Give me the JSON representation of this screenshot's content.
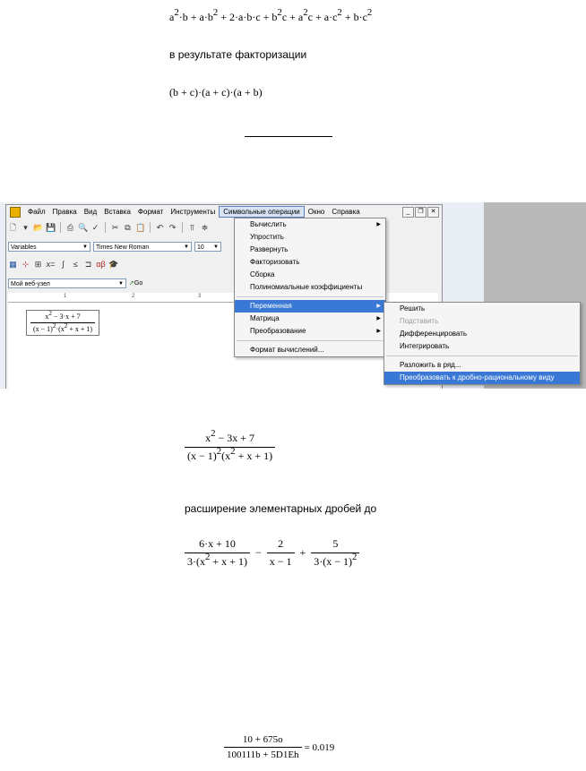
{
  "doc": {
    "expr1": [
      "a",
      "2",
      "·b + a·b",
      "2",
      " + 2·a·b·c + b",
      "2",
      "c + a",
      "2",
      "c + a·c",
      "2",
      " + b·c",
      "2"
    ],
    "label_factor": "в результате факторизации",
    "expr2": "(b + c)·(a + c)·(a + b)",
    "frac1": {
      "num": [
        "x",
        "2",
        " − 3x + 7"
      ],
      "den": [
        "(x − 1)",
        "2",
        "(x",
        "2",
        " + x + 1)"
      ]
    },
    "label_partial": "расширение элементарных дробей до",
    "partial": {
      "t1_num": "6·x + 10",
      "t1_den": [
        "3·(x",
        "2",
        " + x + 1)"
      ],
      "op1": "−",
      "t2_num": "2",
      "t2_den": "x − 1",
      "op2": "+",
      "t3_num": "5",
      "t3_den": [
        "3·(x − 1)",
        "2"
      ]
    },
    "final": {
      "num": "10 + 675o",
      "den": "100111b + 5D1Eh",
      "result": "= 0.019"
    }
  },
  "app": {
    "menu": [
      "Файл",
      "Правка",
      "Вид",
      "Вставка",
      "Формат",
      "Инструменты",
      "Символьные операции",
      "Окно",
      "Справка"
    ],
    "active_menu": "Символьные операции",
    "style_combo": "Variables",
    "font_combo": "Times New Roman",
    "size_combo": "10",
    "url_combo": "Мой веб-узел",
    "go_label": "Go",
    "ruler": [
      "1",
      "2",
      "3"
    ],
    "worksheet_frac": {
      "num": [
        "x",
        "2",
        " − 3·x + 7"
      ],
      "den": [
        "(x − 1)",
        "2",
        "·(x",
        "2",
        " + x + 1)"
      ]
    },
    "symbolic_menu": [
      "Вычислить",
      "Упростить",
      "Развернуть",
      "Факторизовать",
      "Сборка",
      "Полиномиальные коэффициенты",
      "Переменная",
      "Матрица",
      "Преобразование",
      "Формат вычислений..."
    ],
    "variable_submenu": [
      "Решить",
      "Подставить",
      "Дифференцировать",
      "Интегрировать",
      "Разложить в ряд...",
      "Преобразовать к дробно-рациональному виду"
    ],
    "highlight_color": "#3a78d6"
  }
}
